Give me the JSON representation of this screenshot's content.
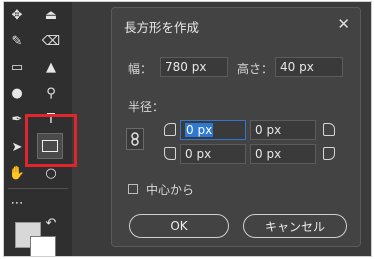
{
  "dialog": {
    "title": "長方形を作成",
    "width_label": "幅：",
    "width_value": "780 px",
    "height_label": "高さ：",
    "height_value": "40 px",
    "radius_label": "半径：",
    "radius": [
      "0 px",
      "0 px",
      "0 px",
      "0 px"
    ],
    "center_label": "中心から",
    "ok": "OK",
    "cancel": "キャンセル"
  },
  "toolbar": {
    "tools": [
      "move-tool",
      "marquee-tool",
      "lasso-tool",
      "crop-tool",
      "brush-tool",
      "eraser-tool",
      "gradient-tool",
      "sharpen-tool",
      "dodge-tool",
      "zoom-tool",
      "pen-tool",
      "path-selection-tool",
      "rectangle-tool",
      "hand-tool",
      "edit-toolbar",
      "foreground-color",
      "background-color"
    ],
    "highlight_color": "#e0262c"
  }
}
